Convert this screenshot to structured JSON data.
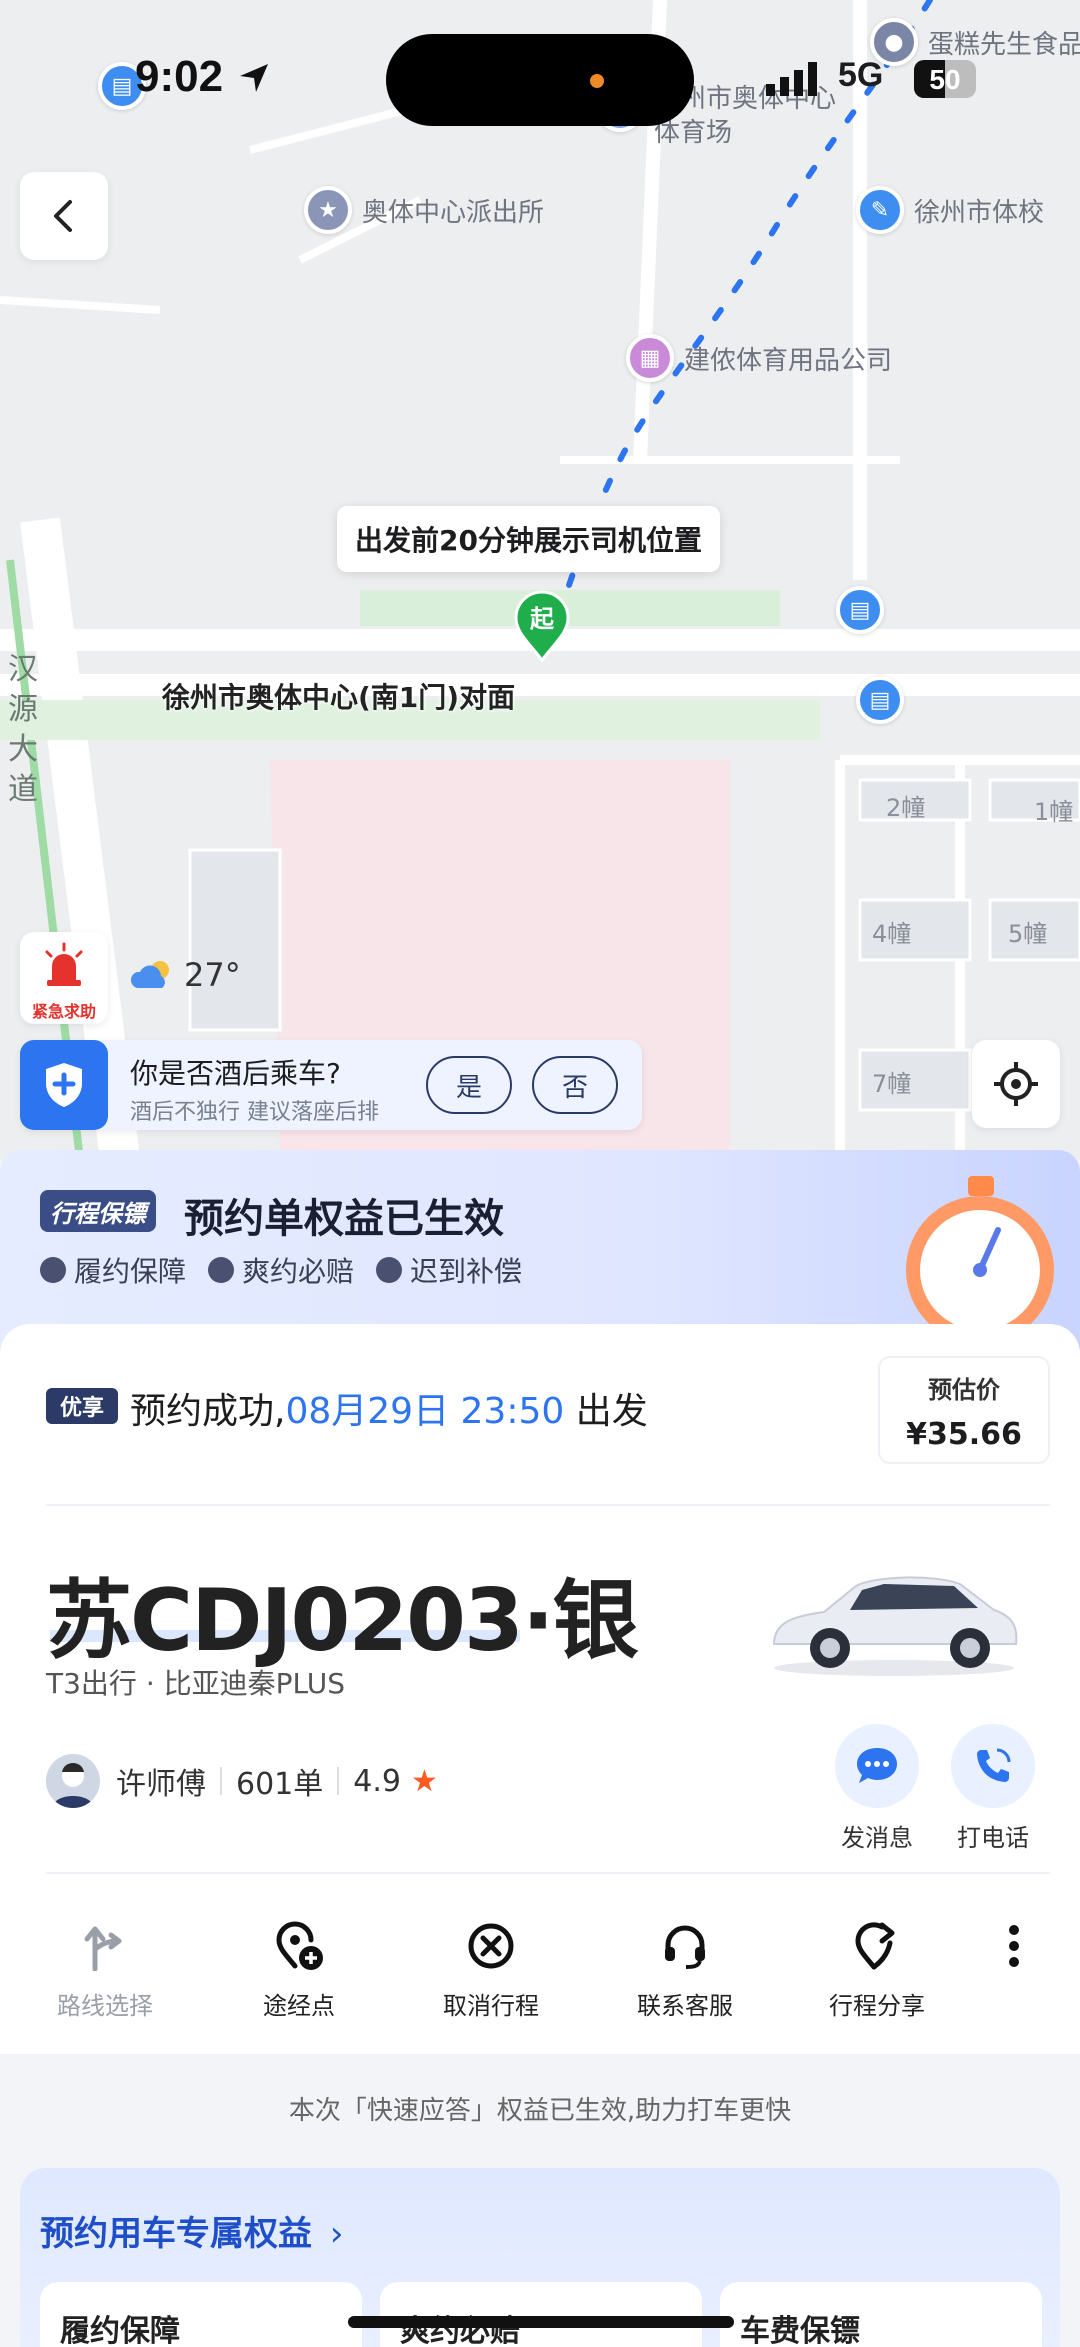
{
  "status_bar": {
    "time": "9:02",
    "network": "5G",
    "battery": "50",
    "battery_level": 0.5
  },
  "map": {
    "pois": [
      {
        "label": "蛋糕先生食品",
        "icon": "lock-icon"
      },
      {
        "label": "徐州市奥体中心",
        "sub": "体育场",
        "icon": "stadium-icon"
      },
      {
        "label": "奥体中心派出所",
        "icon": "police-icon"
      },
      {
        "label": "徐州市体校",
        "icon": "school-icon"
      },
      {
        "label": "建侬体育用品公司",
        "icon": "shop-icon"
      }
    ],
    "driver_bubble": "出发前20分钟展示司机位置",
    "start_pin": "起",
    "pickup_label": "徐州市奥体中心(南1门)对面",
    "road_name": "汉源大道",
    "buildings": [
      "2幢",
      "1幢",
      "4幢",
      "5幢",
      "7幢"
    ]
  },
  "sos": {
    "label": "紧急求助"
  },
  "weather": {
    "temp": "27°",
    "icon": "cloudy-night-icon"
  },
  "drink": {
    "question": "你是否酒后乘车?",
    "hint": "酒后不独行  建议落座后排",
    "yes": "是",
    "no": "否"
  },
  "banner": {
    "logo": "行程保镖",
    "title": "预约单权益已生效",
    "chips": [
      "履约保障",
      "爽约必赔",
      "迟到补偿"
    ]
  },
  "booking": {
    "tag": "优享",
    "prefix": "预约成功,",
    "datetime": "08月29日 23:50",
    "suffix": "出发",
    "price_label": "预估价",
    "price": "¥35.66"
  },
  "vehicle": {
    "plate": "苏CDJ0203·银",
    "model": "T3出行 · 比亚迪秦PLUS"
  },
  "driver": {
    "name": "许师傅",
    "orders": "601单",
    "rating": "4.9",
    "message_label": "发消息",
    "call_label": "打电话"
  },
  "tools": [
    {
      "label": "路线选择",
      "icon": "route-icon"
    },
    {
      "label": "途经点",
      "icon": "waypoint-add-icon"
    },
    {
      "label": "取消行程",
      "icon": "cancel-icon"
    },
    {
      "label": "联系客服",
      "icon": "headset-icon"
    },
    {
      "label": "行程分享",
      "icon": "share-icon"
    }
  ],
  "notice": "本次「快速应答」权益已生效,助力打车更快",
  "exclusive": {
    "title": "预约用车专属权益",
    "cards": [
      "履约保障",
      "爽约必赔",
      "车费保镖"
    ]
  },
  "colors": {
    "accent": "#2d74f0",
    "dark_blue": "#2b3a66",
    "route": "#2d74f0",
    "star": "#ff5a1f"
  }
}
